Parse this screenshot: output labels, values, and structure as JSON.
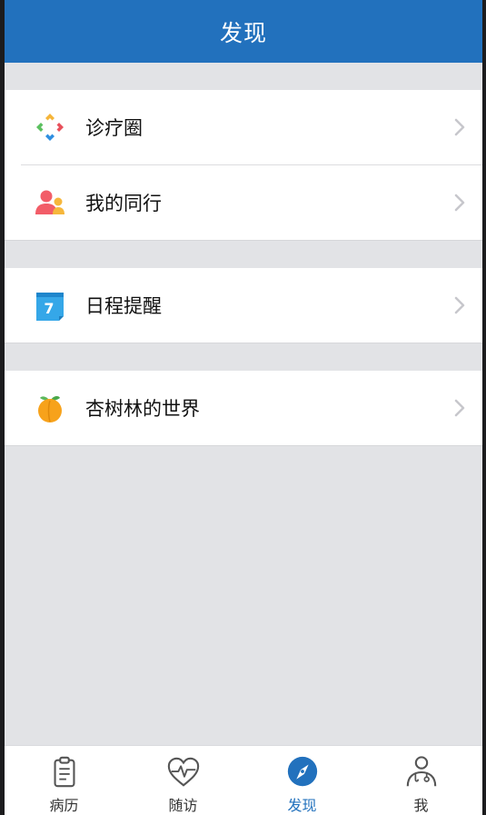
{
  "header": {
    "title": "发现"
  },
  "menu": {
    "items": [
      {
        "label": "诊疗圈",
        "icon": "diamond-arrows-icon"
      },
      {
        "label": "我的同行",
        "icon": "colleagues-icon"
      },
      {
        "label": "日程提醒",
        "icon": "calendar-7-icon",
        "badge": "7"
      },
      {
        "label": "杏树林的世界",
        "icon": "apricot-icon"
      }
    ]
  },
  "tabbar": {
    "tabs": [
      {
        "label": "病历",
        "icon": "clipboard-icon"
      },
      {
        "label": "随访",
        "icon": "heart-pulse-icon"
      },
      {
        "label": "发现",
        "icon": "compass-icon",
        "active": true
      },
      {
        "label": "我",
        "icon": "doctor-icon"
      }
    ]
  },
  "colors": {
    "primary": "#2271bd",
    "background": "#e2e3e6",
    "chevron": "#c7c7cc"
  }
}
